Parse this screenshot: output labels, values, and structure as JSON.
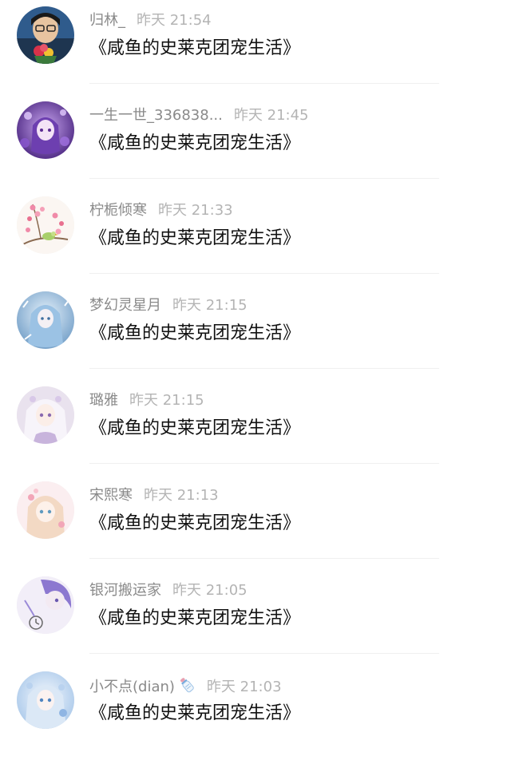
{
  "comments": [
    {
      "username": "归林_",
      "time": "昨天 21:54",
      "message": "《咸鱼的史莱克团宠生活》",
      "avatar_icon": "avatar-man-with-flowers"
    },
    {
      "username": "一生一世_336838...",
      "time": "昨天 21:45",
      "message": "《咸鱼的史莱克团宠生活》",
      "avatar_icon": "avatar-purple-anime-girl"
    },
    {
      "username": "柠栀倾寒",
      "time": "昨天 21:33",
      "message": "《咸鱼的史莱克团宠生活》",
      "avatar_icon": "avatar-cherry-blossom-bird"
    },
    {
      "username": "梦幻灵星月",
      "time": "昨天 21:15",
      "message": "《咸鱼的史莱克团宠生活》",
      "avatar_icon": "avatar-blue-ice-girl"
    },
    {
      "username": "璐雅",
      "time": "昨天 21:15",
      "message": "《咸鱼的史莱克团宠生活》",
      "avatar_icon": "avatar-white-hair-girl"
    },
    {
      "username": "宋熙寒",
      "time": "昨天 21:13",
      "message": "《咸鱼的史莱克团宠生活》",
      "avatar_icon": "avatar-pink-anime-girl"
    },
    {
      "username": "银河搬运家",
      "time": "昨天 21:05",
      "message": "《咸鱼的史莱克团宠生活》",
      "avatar_icon": "avatar-purple-clock-girl"
    },
    {
      "username": "小不点(dian)",
      "username_emoji": "baby-bottle-emoji",
      "time": "昨天 21:03",
      "message": "《咸鱼的史莱克团宠生活》",
      "avatar_icon": "avatar-light-blue-girl"
    }
  ]
}
